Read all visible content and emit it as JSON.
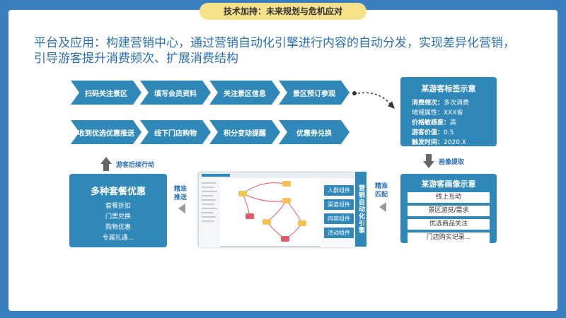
{
  "banner": "技术加持：未来规划与危机应对",
  "headline": [
    "平台及应用：构建营销中心，通过营销自动化引擎进行内容的自动分发，实现差异化营销，",
    "引导游客提升消费频次、扩展消费结构"
  ],
  "flow_row1": [
    "扫码关注景区",
    "填写会员资料",
    "关注景区信息",
    "景区预订参观"
  ],
  "flow_row2": [
    "收到优选优惠推送",
    "线下门店购物",
    "积分变动提醒",
    "优惠券兑换"
  ],
  "tag_card": {
    "title": "某游客标签示意",
    "rows": [
      {
        "k": "消费频次：",
        "v": "多次消费"
      },
      {
        "k": "地域属性：",
        "v": "XXX省"
      },
      {
        "k": "价格敏感度：",
        "v": "高"
      },
      {
        "k": "游客价值：",
        "v": "0.5"
      },
      {
        "k": "触发时间：",
        "v": "2020.X"
      }
    ]
  },
  "portrait_label": "画像提取",
  "portrait_card": {
    "title": "某游客画像示意",
    "items": [
      "线上互动",
      "景区游览/需求",
      "优选商品关注",
      "门店购买记录..."
    ]
  },
  "precise_match": [
    "精准",
    "匹配"
  ],
  "precise_push": [
    "精准",
    "推送"
  ],
  "engine": "营销自动化引擎",
  "components": [
    "人群组件",
    "渠道组件",
    "内容组件",
    "活动组件"
  ],
  "offer_card": {
    "title": "多种套餐优惠",
    "items": [
      "套餐折扣",
      "门票兑换",
      "购物优惠",
      "专属礼遇..."
    ]
  },
  "followup_label": "游客后续行动",
  "colors": {
    "accent": "#2f88b8",
    "frame": "#3a7fc0",
    "banner": "#f6e28a",
    "text": "#2a6fb4"
  }
}
